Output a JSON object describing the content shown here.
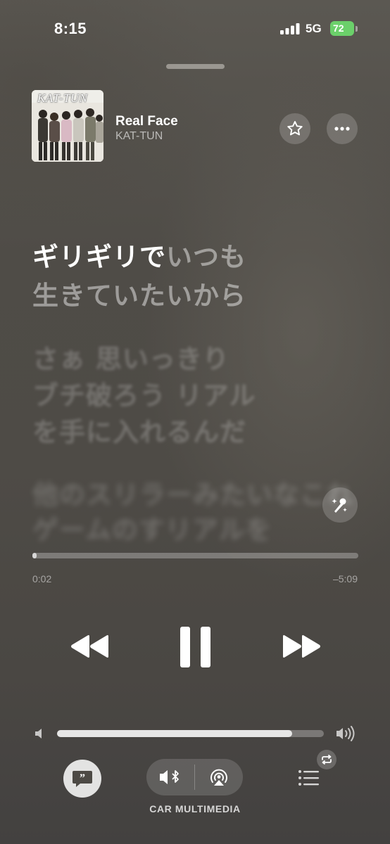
{
  "status_bar": {
    "time": "8:15",
    "network": "5G",
    "battery": "72",
    "battery_color": "#6bd06a"
  },
  "now_playing": {
    "title": "Real Face",
    "artist": "KAT-TUN",
    "artwork_logo": "KAT-TUN",
    "favorite_icon": "star-icon",
    "more_icon": "ellipsis-icon"
  },
  "lyrics": {
    "current_sung": "ギリギリで",
    "current_unsung": "いつも",
    "current_line_2": "生きていたいから",
    "upcoming": [
      "さぁ 思いっきり",
      "ブチ破ろう リアル",
      "を手に入れるんだ"
    ],
    "faded": [
      "他のスリラーみたいなこれ",
      "ゲームのすリアルを"
    ],
    "sing_icon": "microphone-sparkle-icon"
  },
  "playback": {
    "elapsed": "0:02",
    "remaining": "–5:09",
    "progress_fraction": 0.006
  },
  "volume": {
    "level_fraction": 0.88
  },
  "controls": {
    "rewind_icon": "backward-icon",
    "pause_icon": "pause-icon",
    "forward_icon": "forward-icon",
    "lyrics_icon": "quote-bubble-icon",
    "output_device_label": "CAR MULTIMEDIA",
    "queue_icon": "list-icon",
    "repeat_icon": "repeat-icon"
  }
}
